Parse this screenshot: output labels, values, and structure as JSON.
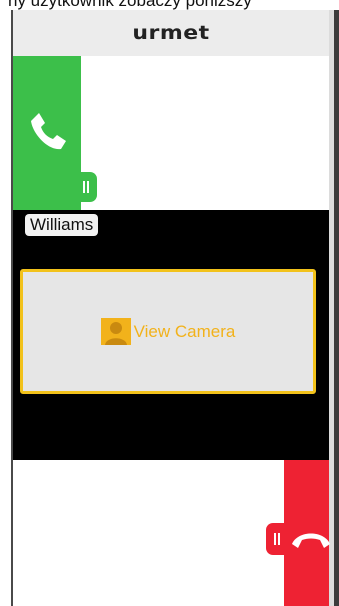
{
  "caption": {
    "text": "ny użytkownik zobaczy poniższy"
  },
  "header": {
    "logo": "urmet"
  },
  "answer": {
    "icon": "phone-answer-icon",
    "color": "#3cbf4a"
  },
  "video": {
    "caller_name": "Williams",
    "view_camera_label": "View Camera",
    "camera_icon": "camera-person-icon",
    "accent": "#f2b21b"
  },
  "hangup": {
    "icon": "phone-hangup-icon",
    "color": "#ee2233"
  }
}
